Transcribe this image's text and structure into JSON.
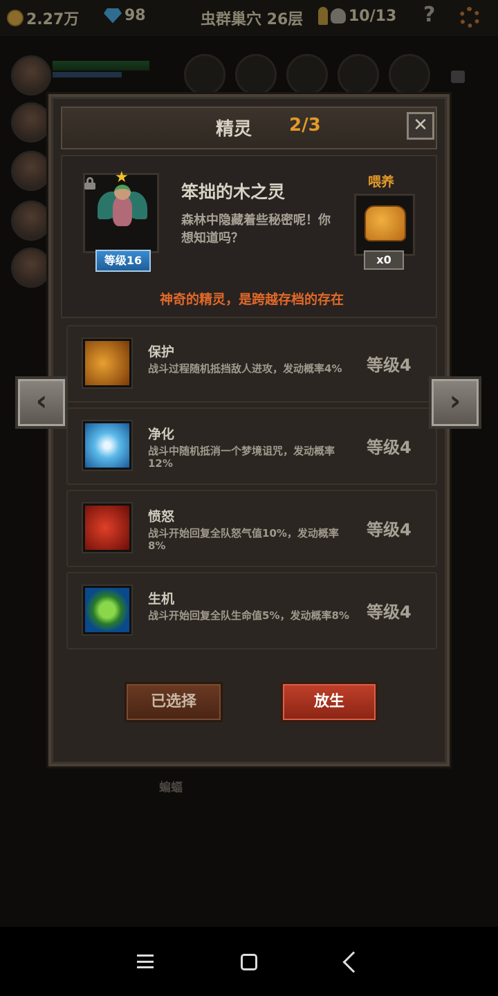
{
  "topbar": {
    "gold": "2.27万",
    "gems": "98",
    "location": "虫群巢穴 26层",
    "keys_skulls": "10/13",
    "help": "?"
  },
  "dialog": {
    "title": "精灵",
    "count": "2/3",
    "close": "✕",
    "sprite": {
      "name": "笨拙的木之灵",
      "description": "森林中隐藏着些秘密呢！你想知道吗？",
      "level": "等级16"
    },
    "feed": {
      "label": "喂养",
      "count": "x0"
    },
    "tagline": "神奇的精灵，是跨越存档的存在",
    "skills": [
      {
        "name": "保护",
        "desc": "战斗过程随机抵挡敌人进攻，发动概率4%",
        "level": "等级4"
      },
      {
        "name": "净化",
        "desc": "战斗中随机抵消一个梦境诅咒，发动概率12%",
        "level": "等级4"
      },
      {
        "name": "愤怒",
        "desc": "战斗开始回复全队怒气值10%，发动概率8%",
        "level": "等级4"
      },
      {
        "name": "生机",
        "desc": "战斗开始回复全队生命值5%，发动概率8%",
        "level": "等级4"
      }
    ],
    "buttons": {
      "selected": "已选择",
      "release": "放生"
    }
  },
  "nav": {
    "prev": "‹",
    "next": "›"
  },
  "background": {
    "label": "蝙蝠"
  },
  "colors": {
    "accent_orange": "#e39a2a",
    "tagline_red": "#e2692a",
    "level_badge_blue": "#2f7fc0",
    "release_button_red": "#b0361f"
  }
}
